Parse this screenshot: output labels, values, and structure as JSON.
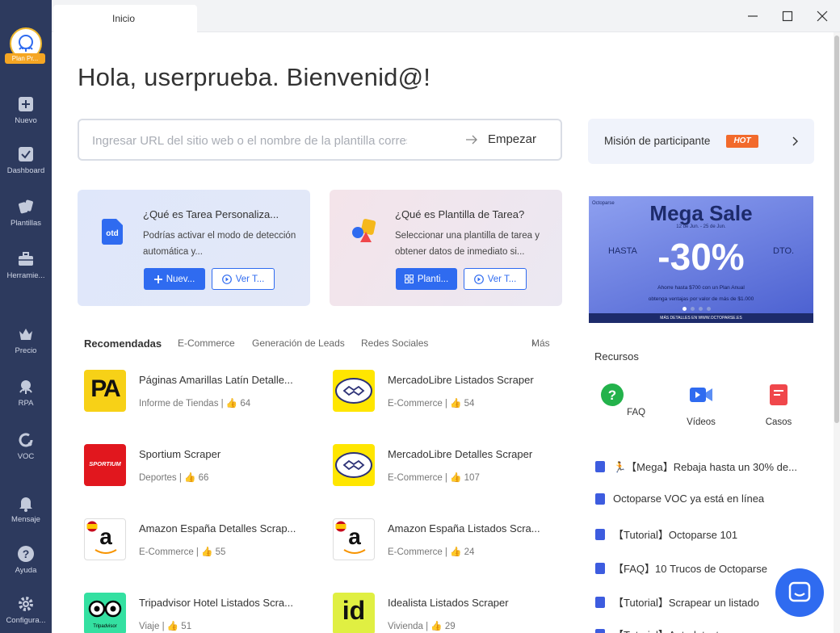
{
  "tab": {
    "label": "Inicio"
  },
  "user": {
    "plan": "Plan Pr..."
  },
  "sidebar": [
    {
      "label": "Nuevo",
      "icon": "plus-square-icon"
    },
    {
      "label": "Dashboard",
      "icon": "check-square-icon"
    },
    {
      "label": "Plantillas",
      "icon": "template-icon"
    },
    {
      "label": "Herramie...",
      "icon": "toolbox-icon"
    },
    {
      "label": "Precio",
      "icon": "crown-icon"
    },
    {
      "label": "RPA",
      "icon": "octopus-icon"
    },
    {
      "label": "VOC",
      "icon": "voc-icon"
    },
    {
      "label": "Mensaje",
      "icon": "bell-icon"
    },
    {
      "label": "Ayuda",
      "icon": "help-icon"
    },
    {
      "label": "Configura...",
      "icon": "gear-icon"
    }
  ],
  "greeting": "Hola, userprueba. Bienvenid@!",
  "search": {
    "placeholder": "Ingresar URL del sitio web o el nombre de la plantilla correspondiente",
    "button": "Empezar"
  },
  "mission": {
    "label": "Misión de participante",
    "badge": "HOT"
  },
  "cards": [
    {
      "title": "¿Qué es Tarea Personaliza...",
      "desc": "Podrías activar el modo de detección automática y...",
      "primary": "Nuev...",
      "secondary": "Ver T..."
    },
    {
      "title": "¿Qué es Plantilla de Tarea?",
      "desc": "Seleccionar una plantilla de tarea y obtener datos de inmediato si...",
      "primary": "Planti...",
      "secondary": "Ver T..."
    }
  ],
  "categories": [
    "Recomendadas",
    "E-Commerce",
    "Generación de Leads",
    "Redes Sociales"
  ],
  "more": "Más",
  "templates": [
    {
      "name": "Páginas Amarillas Latín Detalle...",
      "category": "Informe de Tiendas",
      "likes": "64"
    },
    {
      "name": "MercadoLibre Listados Scraper",
      "category": "E-Commerce",
      "likes": "54"
    },
    {
      "name": "Sportium Scraper",
      "category": "Deportes",
      "likes": "66"
    },
    {
      "name": "MercadoLibre Detalles Scraper",
      "category": "E-Commerce",
      "likes": "107"
    },
    {
      "name": "Amazon España Detalles Scrap...",
      "category": "E-Commerce",
      "likes": "55"
    },
    {
      "name": "Amazon España Listados Scra...",
      "category": "E-Commerce",
      "likes": "24"
    },
    {
      "name": "Tripadvisor Hotel Listados Scra...",
      "category": "Viaje",
      "likes": "51"
    },
    {
      "name": "Idealista Listados Scraper",
      "category": "Vivienda",
      "likes": "29"
    }
  ],
  "banner": {
    "brand": "Octoparse",
    "title": "Mega Sale",
    "dates": "12 de Jun. - 25 de Jun.",
    "hasta": "HASTA",
    "discount": "-30%",
    "dto": "DTO.",
    "line1": "Ahorre hasta $700 con un Plan Anual",
    "line2": "obtenga ventajas por valor de más de $1.000",
    "footer": "MÁS DETALLES EN WWW.OCTOPARSE.ES"
  },
  "resources": {
    "title": "Recursos",
    "items": [
      {
        "label": "FAQ"
      },
      {
        "label": "Vídeos"
      },
      {
        "label": "Casos"
      }
    ]
  },
  "news": [
    "🏃【Mega】Rebaja hasta un 30% de...",
    "Octoparse VOC ya está en línea",
    "【Tutorial】Octoparse 101",
    "【FAQ】10 Trucos de Octoparse",
    "【Tutorial】Scrapear un listado",
    "【Tutorial】Autodetectar..."
  ],
  "logos": {
    "pa": "PA",
    "sportium": "SPORTIUM",
    "id": "id",
    "amazon": "a",
    "trip": "Tripadvisor"
  },
  "colors": {
    "sidebar": "#2d3a5e",
    "accent": "#2f6bf0",
    "hot": "#f26a2c"
  }
}
